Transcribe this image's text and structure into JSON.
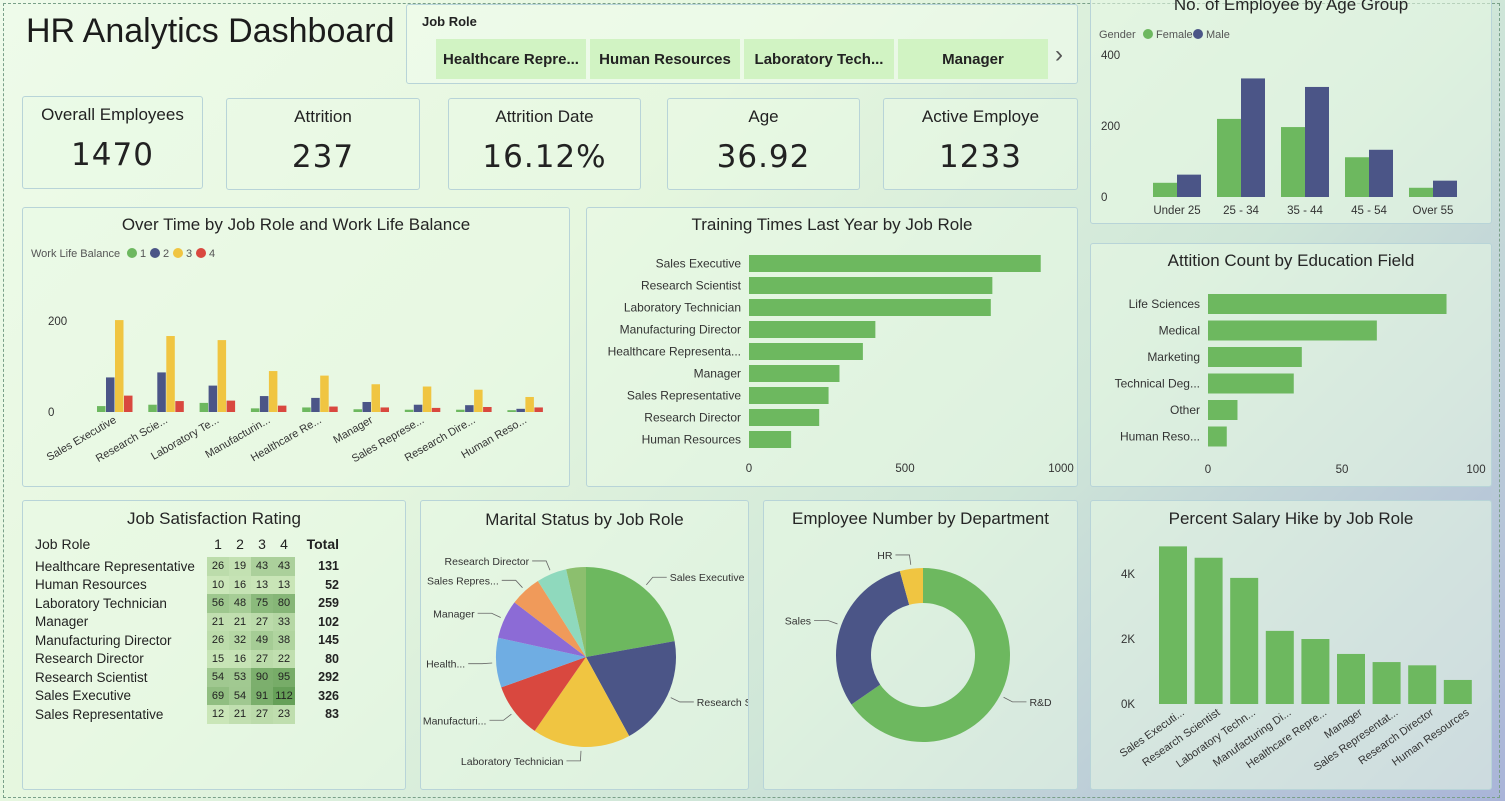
{
  "dashboard_title": "HR Analytics Dashboard",
  "slicer": {
    "label": "Job Role",
    "items": [
      "Healthcare Repre...",
      "Human Resources",
      "Laboratory Tech...",
      "Manager"
    ],
    "next_icon": "chevron-right-icon"
  },
  "kpis": [
    {
      "label": "Overall Employees",
      "value": "1470"
    },
    {
      "label": "Attrition",
      "value": "237"
    },
    {
      "label": "Attrition Date",
      "value": "16.12%"
    },
    {
      "label": "Age",
      "value": "36.92"
    },
    {
      "label": "Active Employe",
      "value": "1233"
    }
  ],
  "colors": {
    "green": "#6db85f",
    "navy": "#4b5587",
    "yellow": "#f0c541",
    "red": "#d9483f"
  },
  "chart_data": [
    {
      "id": "age",
      "type": "bar",
      "title": "No. of Employee by Age Group",
      "legend_title": "Gender",
      "categories": [
        "Under 25",
        "25 - 34",
        "35 - 44",
        "45 - 54",
        "Over 55"
      ],
      "series": [
        {
          "name": "Female",
          "color": "#6db85f",
          "values": [
            40,
            220,
            197,
            112,
            26
          ]
        },
        {
          "name": "Male",
          "color": "#4b5587",
          "values": [
            63,
            334,
            310,
            133,
            46
          ]
        }
      ],
      "yticks": [
        "0",
        "200",
        "400"
      ],
      "ylim": [
        0,
        400
      ],
      "grid": false,
      "legend_position": "top"
    },
    {
      "id": "overtime",
      "type": "bar",
      "title": "Over Time by Job Role and Work Life Balance",
      "legend_title": "Work Life Balance",
      "categories": [
        "Sales Executive",
        "Research Scie...",
        "Laboratory Te...",
        "Manufacturin...",
        "Healthcare Re...",
        "Manager",
        "Sales Represe...",
        "Research Dire...",
        "Human Reso..."
      ],
      "series": [
        {
          "name": "1",
          "color": "#6db85f",
          "values": [
            13,
            16,
            20,
            8,
            10,
            6,
            5,
            5,
            4
          ]
        },
        {
          "name": "2",
          "color": "#4b5587",
          "values": [
            76,
            87,
            58,
            35,
            31,
            22,
            16,
            15,
            7
          ]
        },
        {
          "name": "3",
          "color": "#f0c541",
          "values": [
            202,
            167,
            158,
            90,
            80,
            61,
            56,
            49,
            33
          ]
        },
        {
          "name": "4",
          "color": "#d9483f",
          "values": [
            36,
            24,
            25,
            14,
            12,
            10,
            9,
            11,
            10
          ]
        }
      ],
      "yticks": [
        "0",
        "200"
      ],
      "ylim": [
        0,
        220
      ],
      "grid": false,
      "legend_position": "top-left"
    },
    {
      "id": "training",
      "type": "bar",
      "orientation": "horizontal",
      "title": "Training Times Last Year by Job Role",
      "categories": [
        "Sales Executive",
        "Research Scientist",
        "Laboratory Technician",
        "Manufacturing Director",
        "Healthcare Representa...",
        "Manager",
        "Sales Representative",
        "Research Director",
        "Human Resources"
      ],
      "values": [
        935,
        780,
        775,
        405,
        365,
        290,
        255,
        225,
        135
      ],
      "xticks": [
        "0",
        "500",
        "1000"
      ],
      "xlim": [
        0,
        1000
      ],
      "grid": false
    },
    {
      "id": "education",
      "type": "bar",
      "orientation": "horizontal",
      "title": "Attition Count by Education Field",
      "categories": [
        "Life Sciences",
        "Medical",
        "Marketing",
        "Technical Deg...",
        "Other",
        "Human Reso..."
      ],
      "values": [
        89,
        63,
        35,
        32,
        11,
        7
      ],
      "xticks": [
        "0",
        "50",
        "100"
      ],
      "xlim": [
        0,
        100
      ],
      "grid": false
    },
    {
      "id": "satisfaction",
      "type": "table",
      "title": "Job Satisfaction Rating",
      "columns": [
        "Job Role",
        "1",
        "2",
        "3",
        "4",
        "Total"
      ],
      "rows": [
        {
          "role": "Healthcare Representative",
          "values": [
            26,
            19,
            43,
            43
          ],
          "total": 131
        },
        {
          "role": "Human Resources",
          "values": [
            10,
            16,
            13,
            13
          ],
          "total": 52
        },
        {
          "role": "Laboratory Technician",
          "values": [
            56,
            48,
            75,
            80
          ],
          "total": 259
        },
        {
          "role": "Manager",
          "values": [
            21,
            21,
            27,
            33
          ],
          "total": 102
        },
        {
          "role": "Manufacturing Director",
          "values": [
            26,
            32,
            49,
            38
          ],
          "total": 145
        },
        {
          "role": "Research Director",
          "values": [
            15,
            16,
            27,
            22
          ],
          "total": 80
        },
        {
          "role": "Research Scientist",
          "values": [
            54,
            53,
            90,
            95
          ],
          "total": 292
        },
        {
          "role": "Sales Executive",
          "values": [
            69,
            54,
            91,
            112
          ],
          "total": 326
        },
        {
          "role": "Sales Representative",
          "values": [
            12,
            21,
            27,
            23
          ],
          "total": 83
        }
      ]
    },
    {
      "id": "marital",
      "type": "pie",
      "title": "Marital Status by Job Role",
      "slices": [
        {
          "label": "Sales Executive",
          "value": 326,
          "color": "#6db85f"
        },
        {
          "label": "Research S...",
          "value": 292,
          "color": "#4b5587"
        },
        {
          "label": "Laboratory Technician",
          "value": 259,
          "color": "#f0c541"
        },
        {
          "label": "Manufacturi...",
          "value": 145,
          "color": "#d9483f"
        },
        {
          "label": "Health...",
          "value": 131,
          "color": "#6fade3"
        },
        {
          "label": "Manager",
          "value": 102,
          "color": "#8c6bd6"
        },
        {
          "label": "Sales Repres...",
          "value": 83,
          "color": "#f09a5a"
        },
        {
          "label": "Research Director",
          "value": 80,
          "color": "#8fd9bd"
        },
        {
          "label": "",
          "value": 52,
          "color": "#8cbf6e"
        }
      ]
    },
    {
      "id": "department",
      "type": "pie",
      "donut": true,
      "title": "Employee Number by Department",
      "slices": [
        {
          "label": "R&D",
          "value": 961,
          "color": "#6db85f"
        },
        {
          "label": "Sales",
          "value": 446,
          "color": "#4b5587"
        },
        {
          "label": "HR",
          "value": 63,
          "color": "#f0c541"
        }
      ]
    },
    {
      "id": "salary",
      "type": "bar",
      "title": "Percent Salary Hike by Job Role",
      "categories": [
        "Sales Executi...",
        "Research Scientist",
        "Laboratory Techn...",
        "Manufacturing Di...",
        "Healthcare Repre...",
        "Manager",
        "Sales Representat...",
        "Research Director",
        "Human Resources"
      ],
      "values": [
        4850,
        4500,
        3880,
        2250,
        2000,
        1540,
        1290,
        1190,
        740
      ],
      "yticks": [
        "0K",
        "2K",
        "4K"
      ],
      "ylim": [
        0,
        5000
      ],
      "grid": false
    }
  ]
}
